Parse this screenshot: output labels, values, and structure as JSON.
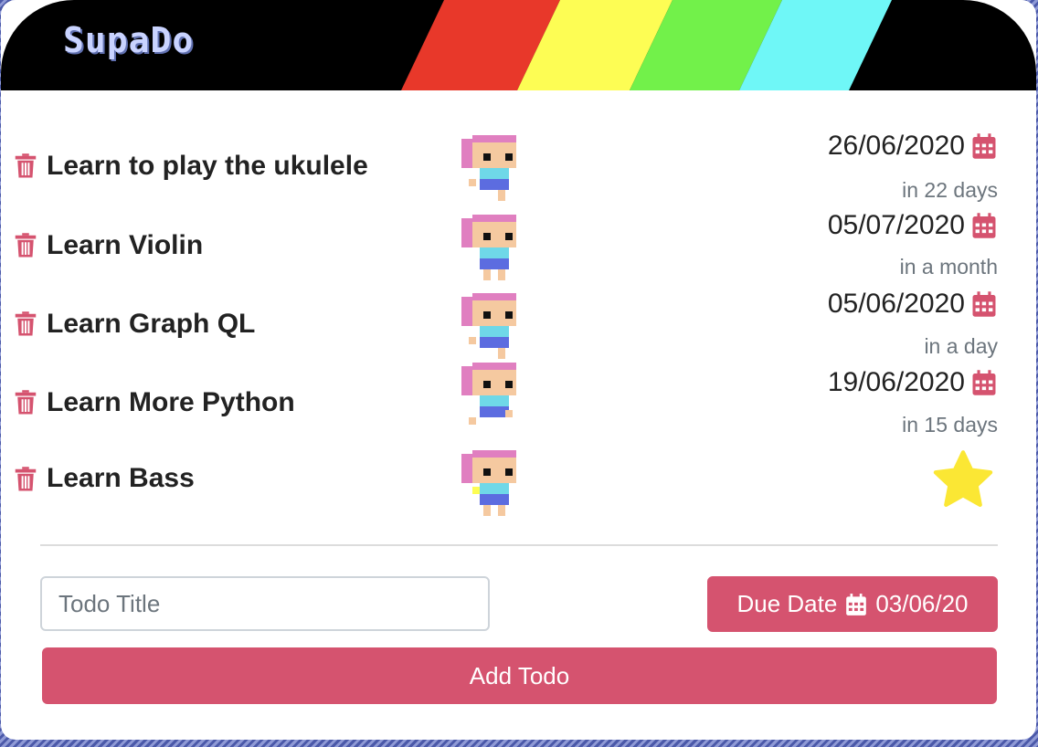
{
  "app": {
    "title": "SupaDo"
  },
  "colors": {
    "accent": "#d5536f",
    "stripe_red": "#e8382a",
    "stripe_yellow": "#fdfd54",
    "stripe_green": "#72f14a",
    "stripe_cyan": "#6ff7f7",
    "star": "#fbe734"
  },
  "todos": [
    {
      "title": "Learn to play the ukulele",
      "due_date": "26/06/2020",
      "relative": "in 22 days",
      "icon": "calendar-icon"
    },
    {
      "title": "Learn Violin",
      "due_date": "05/07/2020",
      "relative": "in a month",
      "icon": "calendar-icon"
    },
    {
      "title": "Learn Graph QL",
      "due_date": "05/06/2020",
      "relative": "in a day",
      "icon": "calendar-icon"
    },
    {
      "title": "Learn More Python",
      "due_date": "19/06/2020",
      "relative": "in 15 days",
      "icon": "calendar-icon"
    },
    {
      "title": "Learn Bass",
      "icon": "star-icon"
    }
  ],
  "form": {
    "title_placeholder": "Todo Title",
    "title_value": "",
    "due_label": "Due Date",
    "due_value": "03/06/20",
    "add_label": "Add Todo"
  }
}
